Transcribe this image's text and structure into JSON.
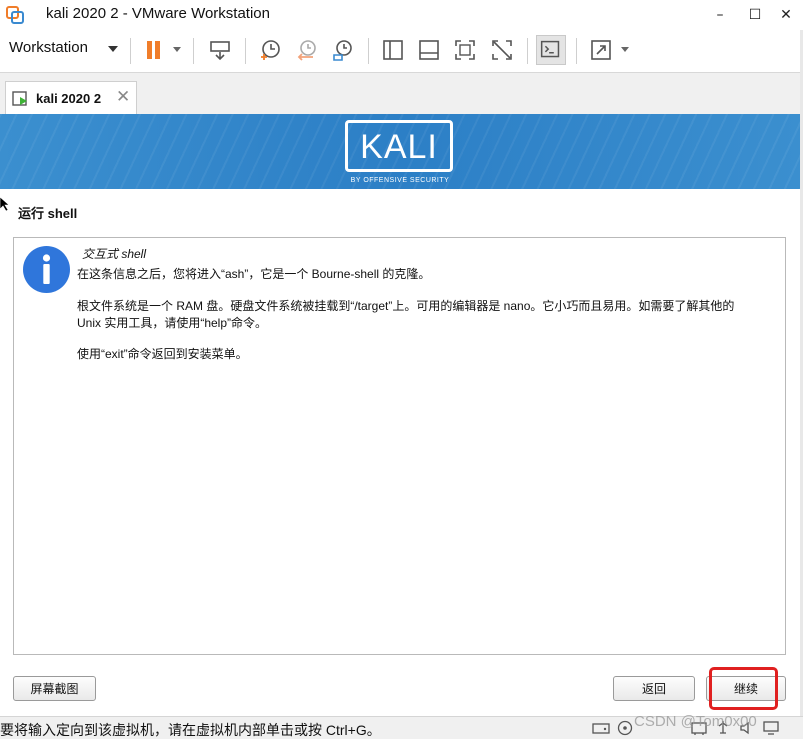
{
  "window": {
    "title": "kali 2020 2 - VMware Workstation",
    "minimize": "–",
    "maximize": "☐",
    "close": "✕"
  },
  "toolbar": {
    "workstation_menu": "Workstation",
    "accent": "#f07d2a"
  },
  "tab": {
    "label": "kali 2020 2",
    "close": "✕"
  },
  "banner": {
    "logo_text": "KALI",
    "logo_subtitle": "BY OFFENSIVE SECURITY",
    "color": "#2c7fc6"
  },
  "installer": {
    "section_title": "运行 shell",
    "dialog_title": "交互式 shell",
    "para1": "在这条信息之后，您将进入“ash”，它是一个 Bourne-shell 的克隆。",
    "para2_line1": "根文件系统是一个 RAM 盘。硬盘文件系统被挂载到“/target”上。可用的编辑器是 nano。它小巧而且易用。如需要了解其他的",
    "para2_line2": "Unix 实用工具，请使用“help”命令。",
    "para3": "使用“exit”命令返回到安装菜单。",
    "screenshot_button": "屏幕截图",
    "back_button": "返回",
    "continue_button": "继续"
  },
  "statusbar": {
    "text": "要将输入定向到该虚拟机，请在虚拟机内部单击或按 Ctrl+G。",
    "watermark": "CSDN @Tom0x00"
  }
}
